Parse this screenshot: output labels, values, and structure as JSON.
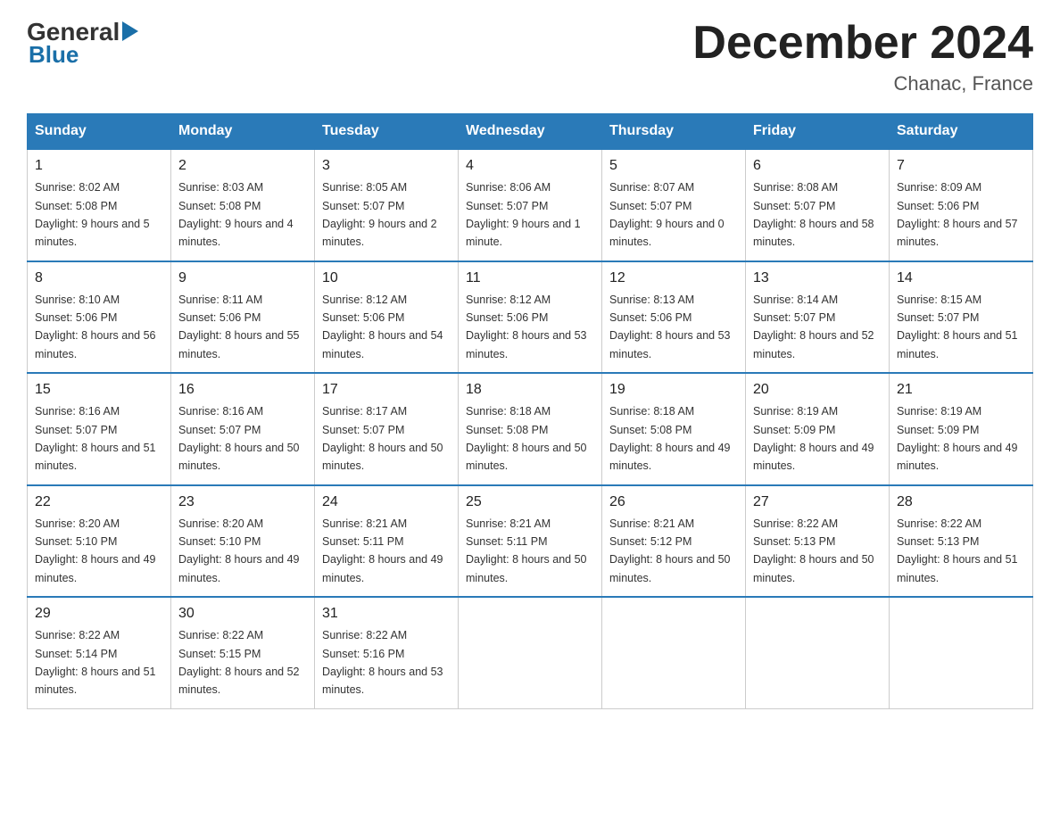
{
  "header": {
    "logo_general": "General",
    "logo_blue": "Blue",
    "title": "December 2024",
    "subtitle": "Chanac, France"
  },
  "days_of_week": [
    "Sunday",
    "Monday",
    "Tuesday",
    "Wednesday",
    "Thursday",
    "Friday",
    "Saturday"
  ],
  "weeks": [
    [
      {
        "day": "1",
        "sunrise": "8:02 AM",
        "sunset": "5:08 PM",
        "daylight": "9 hours and 5 minutes."
      },
      {
        "day": "2",
        "sunrise": "8:03 AM",
        "sunset": "5:08 PM",
        "daylight": "9 hours and 4 minutes."
      },
      {
        "day": "3",
        "sunrise": "8:05 AM",
        "sunset": "5:07 PM",
        "daylight": "9 hours and 2 minutes."
      },
      {
        "day": "4",
        "sunrise": "8:06 AM",
        "sunset": "5:07 PM",
        "daylight": "9 hours and 1 minute."
      },
      {
        "day": "5",
        "sunrise": "8:07 AM",
        "sunset": "5:07 PM",
        "daylight": "9 hours and 0 minutes."
      },
      {
        "day": "6",
        "sunrise": "8:08 AM",
        "sunset": "5:07 PM",
        "daylight": "8 hours and 58 minutes."
      },
      {
        "day": "7",
        "sunrise": "8:09 AM",
        "sunset": "5:06 PM",
        "daylight": "8 hours and 57 minutes."
      }
    ],
    [
      {
        "day": "8",
        "sunrise": "8:10 AM",
        "sunset": "5:06 PM",
        "daylight": "8 hours and 56 minutes."
      },
      {
        "day": "9",
        "sunrise": "8:11 AM",
        "sunset": "5:06 PM",
        "daylight": "8 hours and 55 minutes."
      },
      {
        "day": "10",
        "sunrise": "8:12 AM",
        "sunset": "5:06 PM",
        "daylight": "8 hours and 54 minutes."
      },
      {
        "day": "11",
        "sunrise": "8:12 AM",
        "sunset": "5:06 PM",
        "daylight": "8 hours and 53 minutes."
      },
      {
        "day": "12",
        "sunrise": "8:13 AM",
        "sunset": "5:06 PM",
        "daylight": "8 hours and 53 minutes."
      },
      {
        "day": "13",
        "sunrise": "8:14 AM",
        "sunset": "5:07 PM",
        "daylight": "8 hours and 52 minutes."
      },
      {
        "day": "14",
        "sunrise": "8:15 AM",
        "sunset": "5:07 PM",
        "daylight": "8 hours and 51 minutes."
      }
    ],
    [
      {
        "day": "15",
        "sunrise": "8:16 AM",
        "sunset": "5:07 PM",
        "daylight": "8 hours and 51 minutes."
      },
      {
        "day": "16",
        "sunrise": "8:16 AM",
        "sunset": "5:07 PM",
        "daylight": "8 hours and 50 minutes."
      },
      {
        "day": "17",
        "sunrise": "8:17 AM",
        "sunset": "5:07 PM",
        "daylight": "8 hours and 50 minutes."
      },
      {
        "day": "18",
        "sunrise": "8:18 AM",
        "sunset": "5:08 PM",
        "daylight": "8 hours and 50 minutes."
      },
      {
        "day": "19",
        "sunrise": "8:18 AM",
        "sunset": "5:08 PM",
        "daylight": "8 hours and 49 minutes."
      },
      {
        "day": "20",
        "sunrise": "8:19 AM",
        "sunset": "5:09 PM",
        "daylight": "8 hours and 49 minutes."
      },
      {
        "day": "21",
        "sunrise": "8:19 AM",
        "sunset": "5:09 PM",
        "daylight": "8 hours and 49 minutes."
      }
    ],
    [
      {
        "day": "22",
        "sunrise": "8:20 AM",
        "sunset": "5:10 PM",
        "daylight": "8 hours and 49 minutes."
      },
      {
        "day": "23",
        "sunrise": "8:20 AM",
        "sunset": "5:10 PM",
        "daylight": "8 hours and 49 minutes."
      },
      {
        "day": "24",
        "sunrise": "8:21 AM",
        "sunset": "5:11 PM",
        "daylight": "8 hours and 49 minutes."
      },
      {
        "day": "25",
        "sunrise": "8:21 AM",
        "sunset": "5:11 PM",
        "daylight": "8 hours and 50 minutes."
      },
      {
        "day": "26",
        "sunrise": "8:21 AM",
        "sunset": "5:12 PM",
        "daylight": "8 hours and 50 minutes."
      },
      {
        "day": "27",
        "sunrise": "8:22 AM",
        "sunset": "5:13 PM",
        "daylight": "8 hours and 50 minutes."
      },
      {
        "day": "28",
        "sunrise": "8:22 AM",
        "sunset": "5:13 PM",
        "daylight": "8 hours and 51 minutes."
      }
    ],
    [
      {
        "day": "29",
        "sunrise": "8:22 AM",
        "sunset": "5:14 PM",
        "daylight": "8 hours and 51 minutes."
      },
      {
        "day": "30",
        "sunrise": "8:22 AM",
        "sunset": "5:15 PM",
        "daylight": "8 hours and 52 minutes."
      },
      {
        "day": "31",
        "sunrise": "8:22 AM",
        "sunset": "5:16 PM",
        "daylight": "8 hours and 53 minutes."
      },
      null,
      null,
      null,
      null
    ]
  ],
  "labels": {
    "sunrise": "Sunrise:",
    "sunset": "Sunset:",
    "daylight": "Daylight:"
  }
}
